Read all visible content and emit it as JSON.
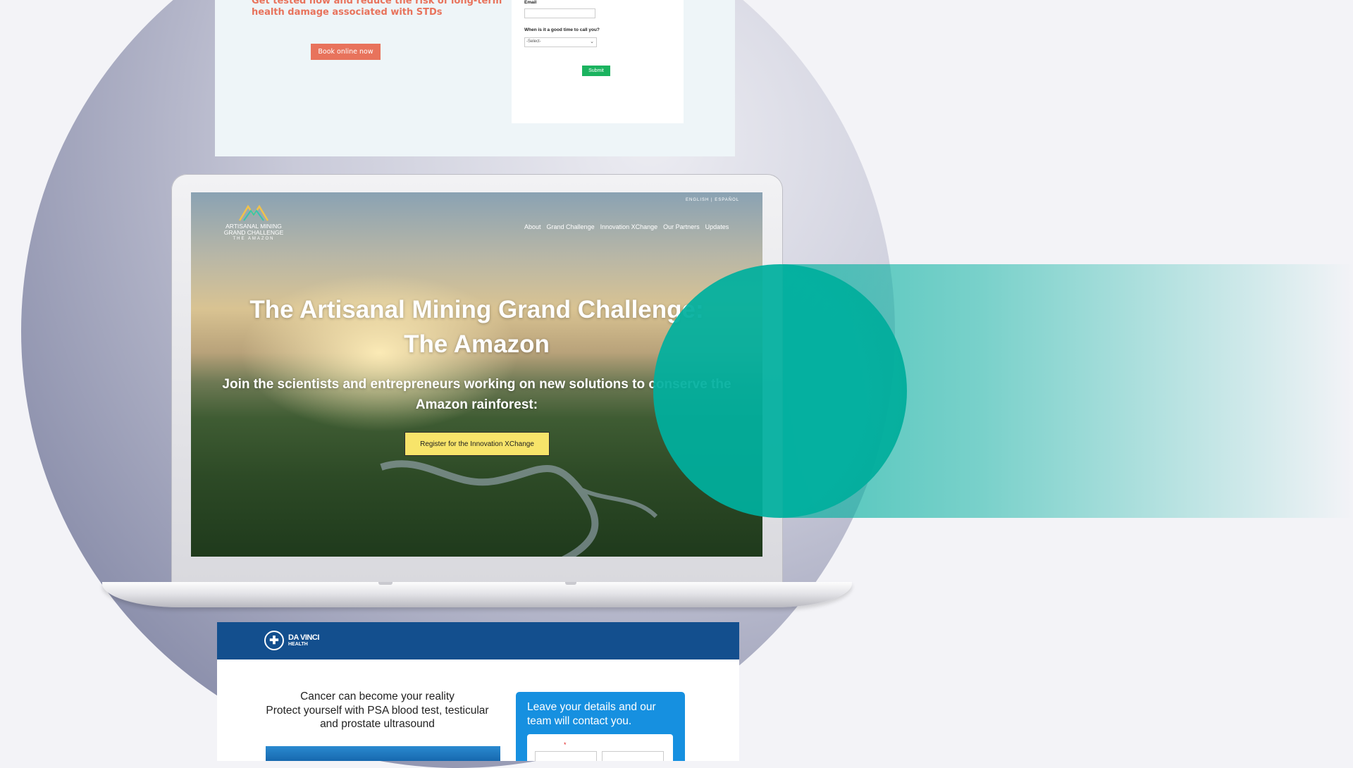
{
  "top_page": {
    "heading": "Get tested now and reduce the risk of long-term health damage associated with STDs",
    "book_label": "Book online now",
    "form": {
      "email_label": "Email",
      "call_time_label": "When is it a good time to call you?",
      "call_time_selected": "-Select-",
      "submit_label": "Submit"
    }
  },
  "laptop_page": {
    "lang_switch": "ENGLISH | ESPAÑOL",
    "logo": {
      "line1": "ARTISANAL MINING",
      "line2": "GRAND CHALLENGE",
      "line3": "THE AMAZON"
    },
    "nav": [
      "About",
      "Grand Challenge",
      "Innovation XChange",
      "Our Partners",
      "Updates"
    ],
    "hero_title_line1": "The Artisanal Mining Grand Challenge:",
    "hero_title_line2": "The Amazon",
    "hero_sub_line1": "Join the scientists and entrepreneurs working on new solutions to conserve the",
    "hero_sub_line2": "Amazon rainforest:",
    "cta_label": "Register for the Innovation XChange"
  },
  "bottom_page": {
    "brand_line1": "DA VINCI",
    "brand_line2": "HEALTH",
    "copy_lines": [
      "Cancer can become your reality",
      "Protect yourself with PSA blood test, testicular",
      "and prostate ultrasound"
    ],
    "form_title": "Leave your details and our team will contact you.",
    "required_mark": "*"
  },
  "colors": {
    "background": "#f3f3f7",
    "teal_accent": "#00af9e",
    "std_orange": "#e8735c",
    "submit_green": "#1bb35f",
    "cta_yellow": "#f7e46a",
    "davinci_blue": "#134f8e",
    "davinci_form_blue": "#1690e0"
  }
}
